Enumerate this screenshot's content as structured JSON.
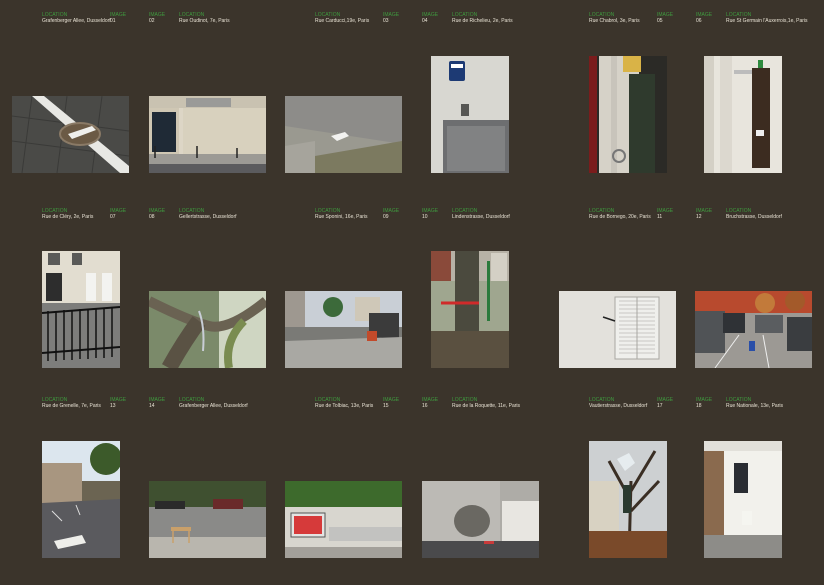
{
  "label_location": "LOCATION",
  "label_image": "IMAGE",
  "images": [
    {
      "num": "01",
      "loc": "Grafenberger Allee, Dusseldorf"
    },
    {
      "num": "02",
      "loc": "Rue Oudinot, 7e, Paris"
    },
    {
      "num": "03",
      "loc": "Rue Carducci,19e, Paris"
    },
    {
      "num": "04",
      "loc": "Rue de Richelieu, 2e, Paris"
    },
    {
      "num": "05",
      "loc": "Rue Chabrol, 3e, Paris"
    },
    {
      "num": "06",
      "loc": "Rue St Germain l'Auxerrois,1e, Paris"
    },
    {
      "num": "07",
      "loc": "Rue de Cléry, 2e, Paris"
    },
    {
      "num": "08",
      "loc": "Gellertstrasse, Dusseldorf"
    },
    {
      "num": "09",
      "loc": "Rue Sponini, 16e, Paris"
    },
    {
      "num": "10",
      "loc": "Lindenstrasse, Dusseldorf"
    },
    {
      "num": "11",
      "loc": "Rue de Bornego, 20e, Paris"
    },
    {
      "num": "12",
      "loc": "Bruchstrasse, Dusseldorf"
    },
    {
      "num": "13",
      "loc": "Rue de Grenelle, 7e, Paris"
    },
    {
      "num": "14",
      "loc": "Grafenberger Allee, Dusseldorf"
    },
    {
      "num": "15",
      "loc": "Rue de Tolbiac, 13e, Paris"
    },
    {
      "num": "16",
      "loc": "Rue de la Roquette, 11e, Paris"
    },
    {
      "num": "17",
      "loc": "Vautierstrasse, Dusseldorf"
    },
    {
      "num": "18",
      "loc": "Rue Nationale, 13e, Paris"
    }
  ],
  "colors": {
    "background": "#3b342b",
    "label": "#3f9a3f",
    "text": "#e9e3d5"
  }
}
